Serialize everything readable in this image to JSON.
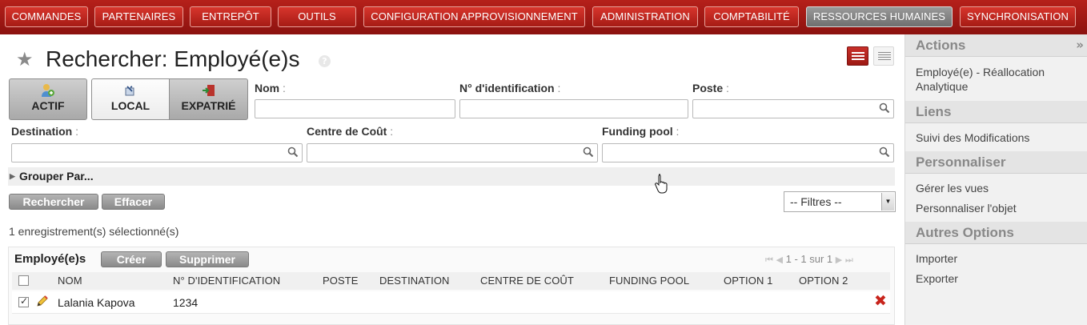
{
  "menu": [
    {
      "label": "COMMANDES",
      "active": false
    },
    {
      "label": "PARTENAIRES",
      "active": false
    },
    {
      "label": "ENTREPÔT",
      "active": false
    },
    {
      "label": "OUTILS",
      "active": false
    },
    {
      "label": "CONFIGURATION APPROVISIONNEMENT",
      "active": false
    },
    {
      "label": "ADMINISTRATION",
      "active": false
    },
    {
      "label": "COMPTABILITÉ",
      "active": false
    },
    {
      "label": "RESSOURCES HUMAINES",
      "active": true
    },
    {
      "label": "SYNCHRONISATION",
      "active": false
    }
  ],
  "page": {
    "title": "Rechercher: Employé(e)s",
    "help": "?"
  },
  "filters": {
    "actif": "ACTIF",
    "local": "LOCAL",
    "expatrie": "EXPATRIÉ"
  },
  "fields": {
    "nom": "Nom",
    "num_id": "N° d'identification",
    "poste": "Poste",
    "destination": "Destination",
    "centre": "Centre de Coût",
    "funding": "Funding pool",
    "colon": ":"
  },
  "groupby": "Grouper Par...",
  "buttons": {
    "search": "Rechercher",
    "clear": "Effacer",
    "create": "Créer",
    "delete": "Supprimer"
  },
  "filter_select": "-- Filtres --",
  "selection_info": "1 enregistrement(s) sélectionné(s)",
  "list": {
    "title": "Employé(e)s",
    "pager": "1 - 1 sur 1",
    "columns": [
      "NOM",
      "N° D'IDENTIFICATION",
      "POSTE",
      "DESTINATION",
      "CENTRE DE COÛT",
      "FUNDING POOL",
      "OPTION 1",
      "OPTION 2"
    ],
    "rows": [
      {
        "nom": "Lalania Kapova",
        "num_id": "1234",
        "checked": true
      }
    ]
  },
  "sidebar": {
    "toggle": "»",
    "actions_head": "Actions",
    "actions": [
      "Employé(e) - Réallocation Analytique"
    ],
    "liens_head": "Liens",
    "liens": [
      "Suivi des Modifications"
    ],
    "perso_head": "Personnaliser",
    "perso": [
      "Gérer les vues",
      "Personnaliser l'objet"
    ],
    "autres_head": "Autres Options",
    "autres": [
      "Importer",
      "Exporter"
    ]
  },
  "colors": {
    "menu_red": "#b5201a",
    "active_gray": "#8a8a8a",
    "delete_red": "#c8241c"
  }
}
